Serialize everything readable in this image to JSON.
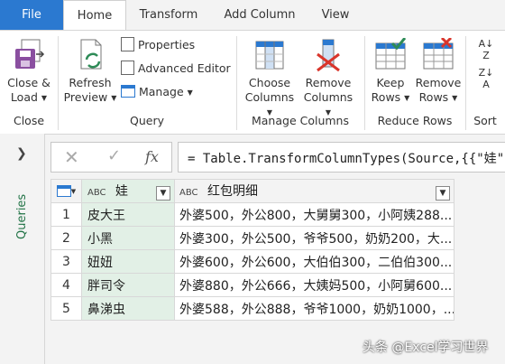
{
  "tabs": [
    {
      "label": "File"
    },
    {
      "label": "Home"
    },
    {
      "label": "Transform"
    },
    {
      "label": "Add Column"
    },
    {
      "label": "View"
    }
  ],
  "ribbon": {
    "close_load": [
      "Close &",
      "Load"
    ],
    "refresh_preview": [
      "Refresh",
      "Preview"
    ],
    "properties": "Properties",
    "advanced_editor": "Advanced Editor",
    "manage": "Manage",
    "choose_columns": [
      "Choose",
      "Columns"
    ],
    "remove_columns": [
      "Remove",
      "Columns"
    ],
    "keep_rows": [
      "Keep",
      "Rows"
    ],
    "remove_rows": [
      "Remove",
      "Rows"
    ],
    "groups": {
      "close": "Close",
      "query": "Query",
      "manage_columns": "Manage Columns",
      "reduce_rows": "Reduce Rows",
      "sort": "Sort"
    }
  },
  "left_pane": {
    "label": "Queries"
  },
  "formula_bar": {
    "fx": "fx",
    "formula": "= Table.TransformColumnTypes(Source,{{\"娃\","
  },
  "grid": {
    "columns": [
      {
        "type": "ABC",
        "name": "娃"
      },
      {
        "type": "ABC",
        "name": "红包明细"
      }
    ],
    "rows": [
      {
        "num": "1",
        "c1": "皮大王",
        "c2": "外婆500，外公800，大舅舅300，小阿姨288..."
      },
      {
        "num": "2",
        "c1": "小黑",
        "c2": "外婆300，外公500，爷爷500，奶奶200，大..."
      },
      {
        "num": "3",
        "c1": "妞妞",
        "c2": "外婆600，外公600，大伯伯300，二伯伯300..."
      },
      {
        "num": "4",
        "c1": "胖司令",
        "c2": "外婆880，外公666，大姨妈500，小阿舅600..."
      },
      {
        "num": "5",
        "c1": "鼻涕虫",
        "c2": "外婆588，外公888，爷爷1000，奶奶1000，..."
      }
    ]
  },
  "watermark": "头条 @Excel学习世界"
}
